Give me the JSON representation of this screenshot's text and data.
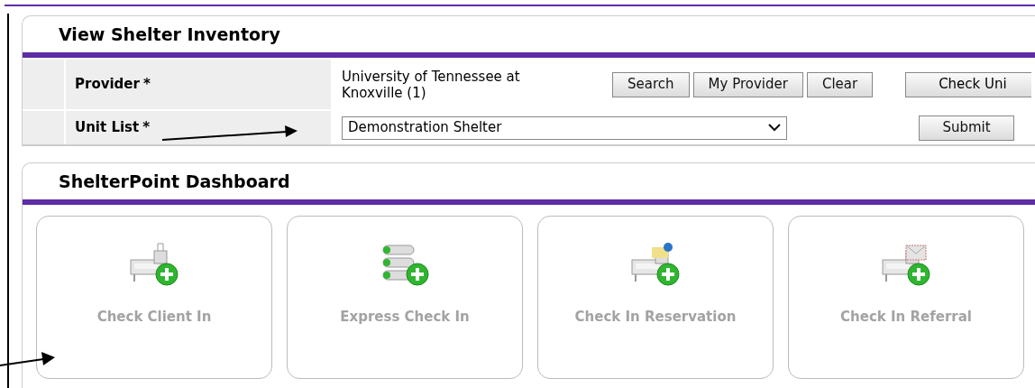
{
  "inventory": {
    "title": "View Shelter Inventory",
    "provider": {
      "label": "Provider",
      "required_mark": "*",
      "value": "University of Tennessee at Knoxville (1)",
      "buttons": [
        "Search",
        "My Provider",
        "Clear"
      ],
      "side_button": "Check Uni"
    },
    "unit_list": {
      "label": "Unit List",
      "required_mark": "*",
      "value": "Demonstration Shelter",
      "button": "Submit"
    }
  },
  "dashboard": {
    "title": "ShelterPoint Dashboard",
    "cards": [
      {
        "label": "Check Client In",
        "kind": "bed"
      },
      {
        "label": "Express Check In",
        "kind": "list"
      },
      {
        "label": "Check In Reservation",
        "kind": "reservation"
      },
      {
        "label": "Check In Referral",
        "kind": "referral"
      }
    ]
  }
}
